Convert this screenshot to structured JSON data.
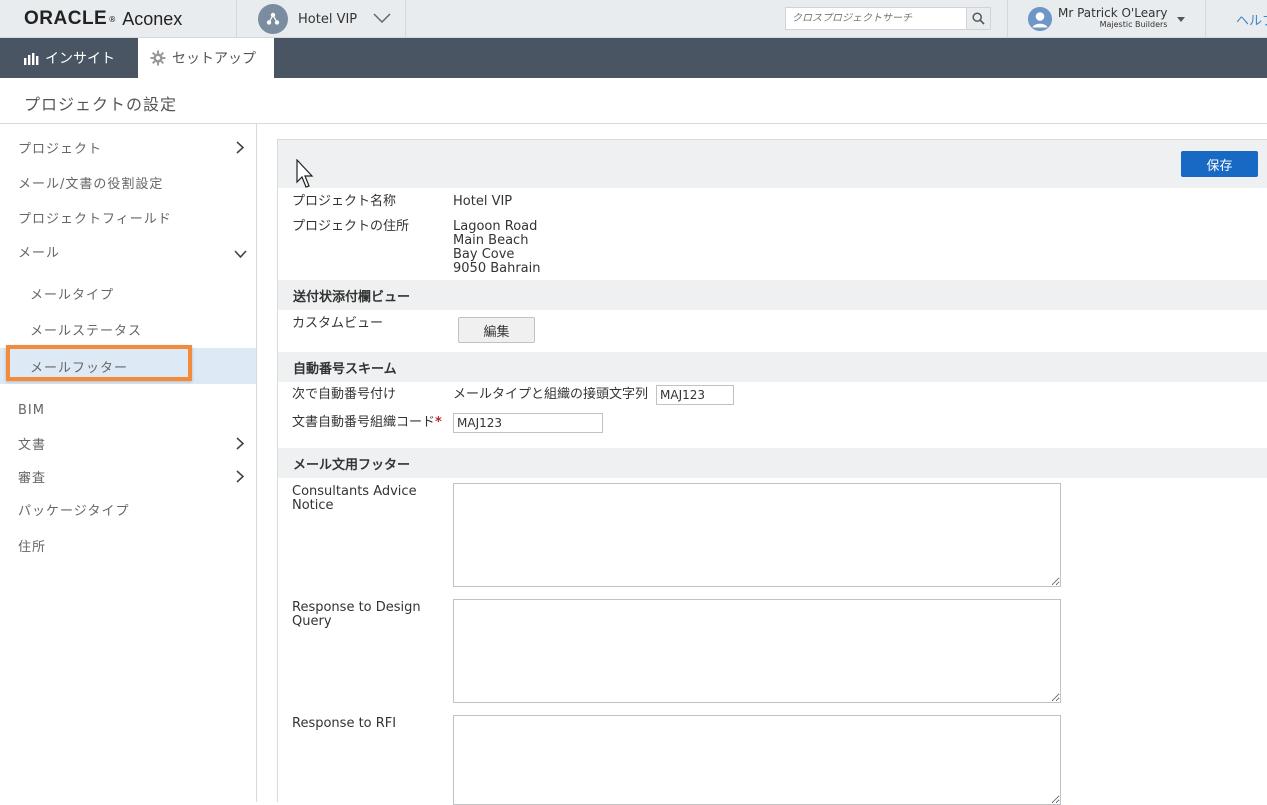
{
  "topbar": {
    "logo_oracle": "ORACLE",
    "logo_reg": "®",
    "logo_aconex": "Aconex",
    "project_name": "Hotel VIP",
    "search_placeholder": "クロスプロジェクトサーチ",
    "user_name": "Mr Patrick O'Leary",
    "user_company": "Majestic Builders",
    "help_label": "ヘルプ"
  },
  "navbar": {
    "tabs": [
      {
        "label": "インサイト",
        "icon": "bar-chart-icon"
      },
      {
        "label": "セットアップ",
        "icon": "gear-icon"
      }
    ]
  },
  "page_title": "プロジェクトの設定",
  "sidebar": {
    "items": [
      {
        "label": "プロジェクト",
        "arrow": "right"
      },
      {
        "label": "メール/文書の役割設定"
      },
      {
        "label": "プロジェクトフィールド"
      },
      {
        "label": "メール",
        "arrow": "down"
      },
      {
        "label": "メールタイプ"
      },
      {
        "label": "メールステータス"
      },
      {
        "label": "メールフッター",
        "active": true
      },
      {
        "label": "BIM"
      },
      {
        "label": "文書",
        "arrow": "right"
      },
      {
        "label": "審査",
        "arrow": "right"
      },
      {
        "label": "パッケージタイプ"
      },
      {
        "label": "住所"
      }
    ]
  },
  "main": {
    "save_label": "保存",
    "project_name_label": "プロジェクト名称",
    "project_name_value": "Hotel VIP",
    "project_address_label": "プロジェクトの住所",
    "address_lines": [
      "Lagoon Road",
      "Main Beach",
      "Bay Cove",
      "9050 Bahrain"
    ],
    "section_transmittal": "送付状添付欄ビュー",
    "custom_view_label": "カスタムビュー",
    "edit_label": "編集",
    "section_numbering": "自動番号スキーム",
    "next_auto_label": "次で自動番号付け",
    "next_auto_value": "メールタイプと組織の接頭文字列",
    "next_auto_input": "MAJ123",
    "doc_org_code_label": "文書自動番号組織コード",
    "required_mark": "*",
    "doc_org_code_input": "MAJ123",
    "section_footer": "メール文用フッター",
    "footers": [
      {
        "label": "Consultants Advice Notice",
        "value": ""
      },
      {
        "label": "Response to Design Query",
        "value": ""
      },
      {
        "label": "Response to RFI",
        "value": ""
      }
    ]
  }
}
